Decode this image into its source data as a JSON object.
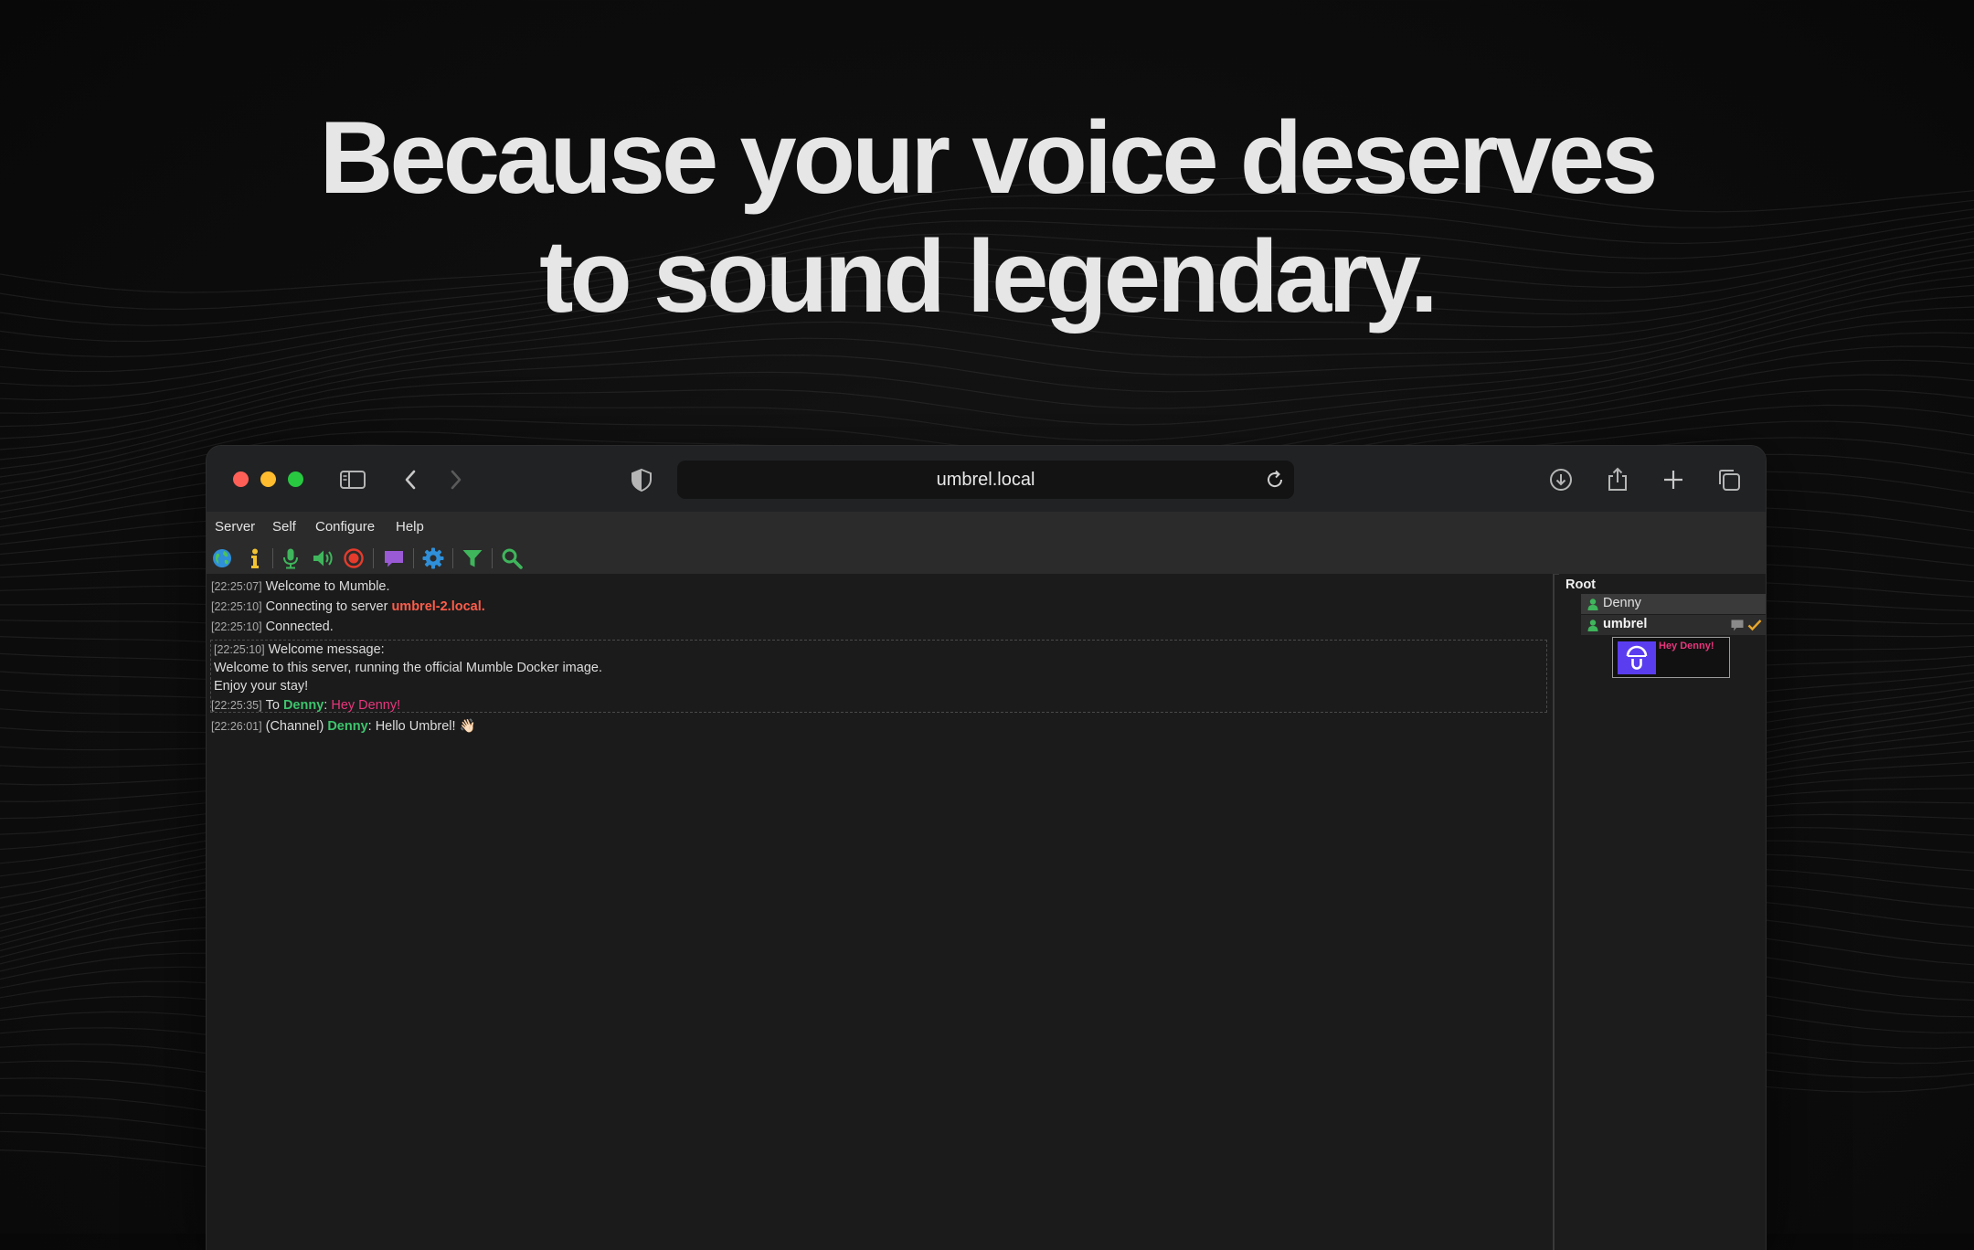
{
  "hero": {
    "line1": "Because your voice deserves",
    "line2": "to sound legendary."
  },
  "browser": {
    "url": "umbrel.local",
    "icons": [
      "sidebar-icon",
      "back-icon",
      "forward-icon",
      "shield-icon",
      "reload-icon",
      "download-icon",
      "share-icon",
      "new-tab-icon",
      "tab-overview-icon"
    ]
  },
  "menu": {
    "items": [
      "Server",
      "Self",
      "Configure",
      "Help"
    ]
  },
  "toolbar": {
    "icons": [
      "connect-globe-icon",
      "info-icon",
      "microphone-icon",
      "speaker-icon",
      "record-icon",
      "comment-icon",
      "settings-gear-icon",
      "filter-icon",
      "search-icon"
    ]
  },
  "log": {
    "line1": {
      "ts": "[22:25:07]",
      "text": "Welcome to Mumble."
    },
    "line2": {
      "ts": "[22:25:10]",
      "prefix": "Connecting to server ",
      "server": "umbrel-2.local",
      "suffix": "."
    },
    "line3": {
      "ts": "[22:25:10]",
      "text": "Connected."
    },
    "welcome": {
      "ts": "[22:25:10]",
      "title": "Welcome message:",
      "body1": "Welcome to this server, running the official Mumble Docker image.",
      "body2": "Enjoy your stay!"
    },
    "line4": {
      "ts": "[22:25:35]",
      "prefix": "To ",
      "user": "Denny",
      "sep": ": ",
      "message": "Hey Denny!"
    },
    "line5": {
      "ts": "[22:26:01]",
      "prefix": "(Channel) ",
      "user": "Denny",
      "sep": ": ",
      "message": "Hello Umbrel! 👋🏻"
    }
  },
  "tree": {
    "root": "Root",
    "users": [
      {
        "name": "Denny"
      },
      {
        "name": "umbrel",
        "self": true
      }
    ],
    "tooltip": "Hey Denny!"
  },
  "colors": {
    "accent_red": "#ff5d4a",
    "user_green": "#3ec46d",
    "message_pink": "#e8367c",
    "avatar_purple": "#5b3df0"
  }
}
